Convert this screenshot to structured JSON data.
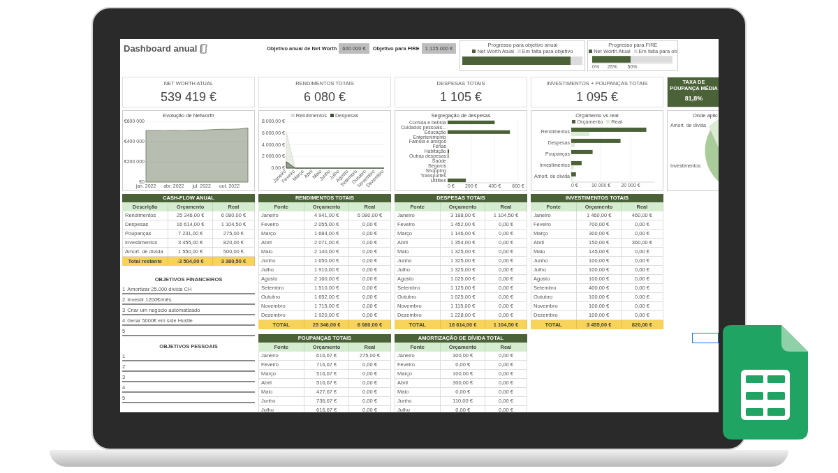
{
  "header": {
    "title": "Dashboard anual",
    "goals": [
      {
        "label": "Objetivo anual de Net Worth",
        "value": "600 000 €"
      },
      {
        "label": "Objetivo para FIRE",
        "value": "1 125 000 €"
      }
    ]
  },
  "progress": [
    {
      "kind": "level",
      "title": "Progresso para objetivo anual",
      "legend": [
        {
          "label": "Net Worth Atual",
          "color": "#4b6137"
        },
        {
          "label": "Em falta para objetivo",
          "color": "#dcdcdc"
        }
      ],
      "level": 0.9
    },
    {
      "kind": "chart",
      "chart_data": {
        "type": "bar",
        "orientation": "horizontal",
        "stacked": true,
        "title": "Progresso para FIRE",
        "xlim": [
          0,
          100
        ],
        "xticks": [
          {
            "value": 0,
            "label": "0%"
          },
          {
            "value": 25,
            "label": "25%"
          },
          {
            "value": 50,
            "label": "50%"
          }
        ],
        "series": [
          {
            "name": "Net Worth Atual",
            "color": "#4b6137",
            "values": [
              48
            ]
          },
          {
            "name": "Em falta para ob",
            "color": "#dcdcdc",
            "values": [
              52
            ]
          }
        ]
      }
    }
  ],
  "kpis": [
    {
      "label": "NET WORTH ATUAL",
      "value": "539 419 €",
      "highlighted": false
    },
    {
      "label": "RENDIMENTOS TOTAIS",
      "value": "6 080 €",
      "highlighted": false
    },
    {
      "label": "DESPESAS TOTAIS",
      "value": "1 105 €",
      "highlighted": false
    },
    {
      "label": "INVESTIMENTOS + POUPANÇAS TOTAIS",
      "value": "1 095 €",
      "highlighted": false
    },
    {
      "label": "TAXA DE POUPANÇA MÉDIA",
      "value": "81,8%",
      "highlighted": true
    }
  ],
  "charts": [
    {
      "kind": "chart",
      "chart_data": {
        "type": "area",
        "title": "Evolução de Networth",
        "grid": true,
        "categories": [
          "jan. 2022",
          null,
          null,
          "abr. 2022",
          null,
          null,
          "jul. 2022",
          null,
          null,
          "out. 2022",
          null,
          null
        ],
        "ylim": [
          0,
          600000
        ],
        "yticks": [
          {
            "value": 0,
            "label": "€0"
          },
          {
            "value": 200000,
            "label": "€200 000"
          },
          {
            "value": 400000,
            "label": "€400 000"
          },
          {
            "value": 600000,
            "label": "€600 000"
          }
        ],
        "series": [
          {
            "color": "#6f7d63",
            "values": [
              510000,
              510000,
              508000,
              511000,
              508000,
              512000,
              512000,
              518000,
              522000,
              522000,
              525000,
              535000
            ]
          }
        ]
      }
    },
    {
      "kind": "chart",
      "chart_data": {
        "type": "area",
        "grid": true,
        "categories": [
          "Janeiro",
          "Feveiro",
          "Março",
          "Abril",
          "Maio",
          "Junho",
          "Julho",
          "Agosto",
          "Setembro",
          "Outubro",
          "Novembro",
          "Dezembro"
        ],
        "ylim": [
          0,
          8000
        ],
        "yticks": [
          {
            "value": 0,
            "label": "0,00 €"
          },
          {
            "value": 2000,
            "label": "2 000,00 €"
          },
          {
            "value": 4000,
            "label": "4 000,00 €"
          },
          {
            "value": 6000,
            "label": "6 000,00 €"
          },
          {
            "value": 8000,
            "label": "8 000,00 €"
          }
        ],
        "series": [
          {
            "name": "Rendimentos",
            "color": "#d5ddd0",
            "values": [
              6100,
              0,
              0,
              0,
              0,
              0,
              0,
              0,
              0,
              0,
              0,
              0
            ]
          },
          {
            "name": "Despesas",
            "color": "#3f4f35",
            "values": [
              1100,
              0,
              0,
              0,
              0,
              0,
              0,
              0,
              0,
              0,
              0,
              0
            ]
          }
        ]
      }
    },
    {
      "kind": "chart",
      "chart_data": {
        "type": "bar",
        "orientation": "horizontal",
        "grid": true,
        "title": "Segregação de despesas",
        "categories": [
          "Comida e bebida",
          "Cuidados pessoais...",
          "Educação",
          "Entertenimento",
          "Família e amigos",
          "Férias",
          "Habitação",
          "Outras despesas",
          "Saúde",
          "Seguros",
          "Shopping",
          "Transportes",
          "Utilities"
        ],
        "xlim": [
          0,
          600
        ],
        "xticks": [
          {
            "value": 0,
            "label": "0 €"
          },
          {
            "value": 200,
            "label": "200 €"
          },
          {
            "value": 400,
            "label": "400 €"
          },
          {
            "value": 600,
            "label": "600 €"
          }
        ],
        "series": [
          {
            "color": "#4b6137",
            "values": [
              400,
              0,
              530,
              0,
              0,
              0,
              12,
              8,
              0,
              0,
              0,
              0,
              155
            ]
          }
        ]
      }
    },
    {
      "kind": "chart",
      "chart_data": {
        "type": "bar",
        "orientation": "horizontal",
        "grid": true,
        "title": "Orçamento vs real",
        "categories": [
          "Rendimentos",
          "Despesas",
          "Poupanças",
          "Investimentos",
          "Amort. de dívida"
        ],
        "xlim": [
          0,
          28000
        ],
        "xticks": [
          {
            "value": 0,
            "label": "0 €"
          },
          {
            "value": 10000,
            "label": "10 000 €"
          },
          {
            "value": 20000,
            "label": "20 000 €"
          }
        ],
        "series": [
          {
            "name": "Orçamento",
            "color": "#4b6137",
            "values": [
              25300,
              16600,
              7200,
              3500,
              1600
            ]
          },
          {
            "name": "Real",
            "color": "#dcebd3",
            "values": [
              6100,
              1100,
              null,
              800,
              500
            ]
          }
        ]
      }
    },
    {
      "kind": "pie",
      "title": "Onde aplic",
      "labels": [
        "Amort. de dívida",
        "Investimentos"
      ]
    }
  ],
  "tables": [
    {
      "title": "CASH-FLOW ANUAL",
      "columns": [
        "Descrição",
        "Orçamento",
        "Real"
      ],
      "rows": [
        [
          "Rendimentos",
          "25 346,00 €",
          "6 080,00 €"
        ],
        [
          "Despesas",
          "16 614,00 €",
          "1 104,50 €"
        ],
        [
          "Poupanças",
          "7 231,00 €",
          "275,00 €"
        ],
        [
          "Investimentos",
          "3 455,00 €",
          "820,00 €"
        ],
        [
          "Amort. de dívida",
          "1 550,00 €",
          "500,00 €"
        ]
      ],
      "total": [
        "Total restante",
        "-3 504,00 €",
        "3 380,50 €"
      ]
    },
    {
      "title": "RENDIMENTOS TOTAIS",
      "columns": [
        "Fonte",
        "Orçamento",
        "Real"
      ],
      "rows": [
        [
          "Janeiro",
          "4 941,00 €",
          "6 080,00 €"
        ],
        [
          "Feveiro",
          "2 055,00 €",
          "0,00 €"
        ],
        [
          "Março",
          "1 684,00 €",
          "0,00 €"
        ],
        [
          "Abril",
          "2 071,00 €",
          "0,00 €"
        ],
        [
          "Maio",
          "2 140,00 €",
          "0,00 €"
        ],
        [
          "Junho",
          "1 650,00 €",
          "0,00 €"
        ],
        [
          "Julho",
          "1 910,00 €",
          "0,00 €"
        ],
        [
          "Agosto",
          "2 160,00 €",
          "0,00 €"
        ],
        [
          "Setembro",
          "1 510,00 €",
          "0,00 €"
        ],
        [
          "Outubro",
          "1 652,00 €",
          "0,00 €"
        ],
        [
          "Novembro",
          "1 715,00 €",
          "0,00 €"
        ],
        [
          "Dezembro",
          "1 920,00 €",
          "0,00 €"
        ]
      ],
      "total": [
        "TOTAL",
        "25 346,00 €",
        "6 080,00 €"
      ]
    },
    {
      "title": "DESPESAS TOTAIS",
      "columns": [
        "Fonte",
        "Orçamento",
        "Real"
      ],
      "rows": [
        [
          "Janeiro",
          "3 188,00 €",
          "1 104,50 €"
        ],
        [
          "Feveiro",
          "1 452,00 €",
          "0,00 €"
        ],
        [
          "Março",
          "1 146,00 €",
          "0,00 €"
        ],
        [
          "Abril",
          "1 354,00 €",
          "0,00 €"
        ],
        [
          "Maio",
          "1 325,00 €",
          "0,00 €"
        ],
        [
          "Junho",
          "1 325,00 €",
          "0,00 €"
        ],
        [
          "Julho",
          "1 325,00 €",
          "0,00 €"
        ],
        [
          "Agosto",
          "1 025,00 €",
          "0,00 €"
        ],
        [
          "Setembro",
          "1 125,00 €",
          "0,00 €"
        ],
        [
          "Outubro",
          "1 025,00 €",
          "0,00 €"
        ],
        [
          "Novembro",
          "1 115,00 €",
          "0,00 €"
        ],
        [
          "Dezembro",
          "1 228,00 €",
          "0,00 €"
        ]
      ],
      "total": [
        "TOTAL",
        "16 614,00 €",
        "1 104,50 €"
      ]
    },
    {
      "title": "INVESTIMENTOS TOTAIS",
      "columns": [
        "Fonte",
        "Orçamento",
        "Real"
      ],
      "rows": [
        [
          "Janeiro",
          "1 460,00 €",
          "460,00 €"
        ],
        [
          "Feveiro",
          "700,00 €",
          "0,00 €"
        ],
        [
          "Março",
          "300,00 €",
          "0,00 €"
        ],
        [
          "Abril",
          "150,00 €",
          "360,00 €"
        ],
        [
          "Maio",
          "145,00 €",
          "0,00 €"
        ],
        [
          "Junho",
          "100,00 €",
          "0,00 €"
        ],
        [
          "Julho",
          "100,00 €",
          "0,00 €"
        ],
        [
          "Agosto",
          "100,00 €",
          "0,00 €"
        ],
        [
          "Setembro",
          "400,00 €",
          "0,00 €"
        ],
        [
          "Outubro",
          "100,00 €",
          "0,00 €"
        ],
        [
          "Novembro",
          "100,00 €",
          "0,00 €"
        ],
        [
          "Dezembro",
          "100,00 €",
          "0,00 €"
        ]
      ],
      "total": [
        "TOTAL",
        "3 455,00 €",
        "820,00 €"
      ]
    },
    {
      "title": "POUPANÇAS TOTAIS",
      "columns": [
        "Fonte",
        "Orçamento",
        "Real"
      ],
      "rows": [
        [
          "Janeiro",
          "616,67 €",
          "275,00 €"
        ],
        [
          "Feveiro",
          "716,67 €",
          "0,00 €"
        ],
        [
          "Março",
          "516,67 €",
          "0,00 €"
        ],
        [
          "Abril",
          "516,67 €",
          "0,00 €"
        ],
        [
          "Maio",
          "427,67 €",
          "0,00 €"
        ],
        [
          "Junho",
          "736,67 €",
          "0,00 €"
        ],
        [
          "Julho",
          "616,67 €",
          "0,00 €"
        ]
      ]
    },
    {
      "title": "AMORTIZAÇÃO DE DÍVIDA TOTAL",
      "columns": [
        "Fonte",
        "Orçamento",
        "Real"
      ],
      "rows": [
        [
          "Janeiro",
          "300,00 €",
          "0,00 €"
        ],
        [
          "Feveiro",
          "0,00 €",
          "0,00 €"
        ],
        [
          "Março",
          "100,00 €",
          "0,00 €"
        ],
        [
          "Abril",
          "300,00 €",
          "0,00 €"
        ],
        [
          "Maio",
          "0,00 €",
          "0,00 €"
        ],
        [
          "Junho",
          "110,00 €",
          "0,00 €"
        ],
        [
          "Julho",
          "0,00 €",
          "0,00 €"
        ]
      ]
    }
  ],
  "goal_lists": [
    {
      "title": "OBJETIVOS FINANCEIROS",
      "items": [
        {
          "number": "1",
          "text": "Amortizar 25.000 dívida CH"
        },
        {
          "number": "2",
          "text": "Investir 1200€/mês"
        },
        {
          "number": "3",
          "text": "Criar um negócio automatizado"
        },
        {
          "number": "4",
          "text": "Gerar 5000€ em side Hustle"
        },
        {
          "number": "5"
        }
      ]
    },
    {
      "title": "OBJETIVOS PESSOAIS",
      "items": [
        {
          "number": "1"
        },
        {
          "number": "2"
        },
        {
          "number": "3"
        },
        {
          "number": "4"
        },
        {
          "number": "5"
        }
      ]
    }
  ]
}
